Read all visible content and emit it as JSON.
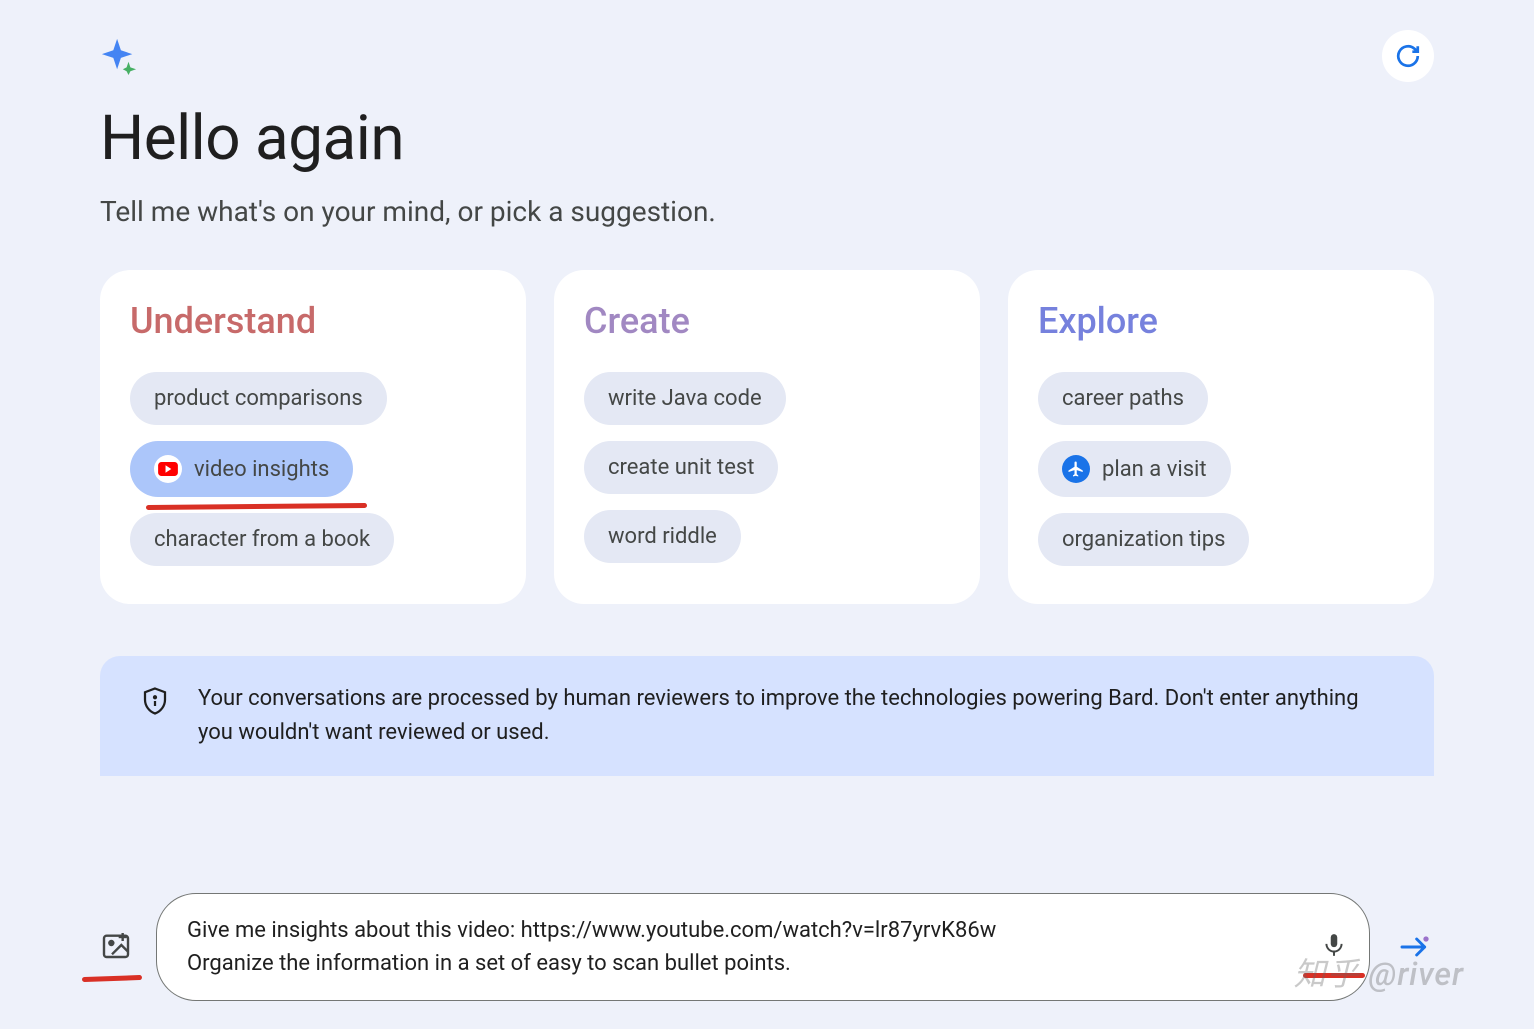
{
  "greeting": "Hello again",
  "subtitle": "Tell me what's on your mind, or pick a suggestion.",
  "cards": {
    "understand": {
      "title": "Understand",
      "chips": [
        {
          "label": "product comparisons",
          "icon": null,
          "active": false
        },
        {
          "label": "video insights",
          "icon": "youtube",
          "active": true,
          "underlined": true
        },
        {
          "label": "character from a book",
          "icon": null,
          "active": false
        }
      ]
    },
    "create": {
      "title": "Create",
      "chips": [
        {
          "label": "write Java code",
          "icon": null,
          "active": false
        },
        {
          "label": "create unit test",
          "icon": null,
          "active": false
        },
        {
          "label": "word riddle",
          "icon": null,
          "active": false
        }
      ]
    },
    "explore": {
      "title": "Explore",
      "chips": [
        {
          "label": "career paths",
          "icon": null,
          "active": false
        },
        {
          "label": "plan a visit",
          "icon": "plane",
          "active": false
        },
        {
          "label": "organization tips",
          "icon": null,
          "active": false
        }
      ]
    }
  },
  "notice": "Your conversations are processed by human reviewers to improve the technologies powering Bard. Don't enter anything you wouldn't want reviewed or used.",
  "input_text": "Give me insights about this video: https://www.youtube.com/watch?v=lr87yrvK86w\nOrganize the information in a set of easy to scan bullet points.",
  "watermark": "知乎 @river"
}
